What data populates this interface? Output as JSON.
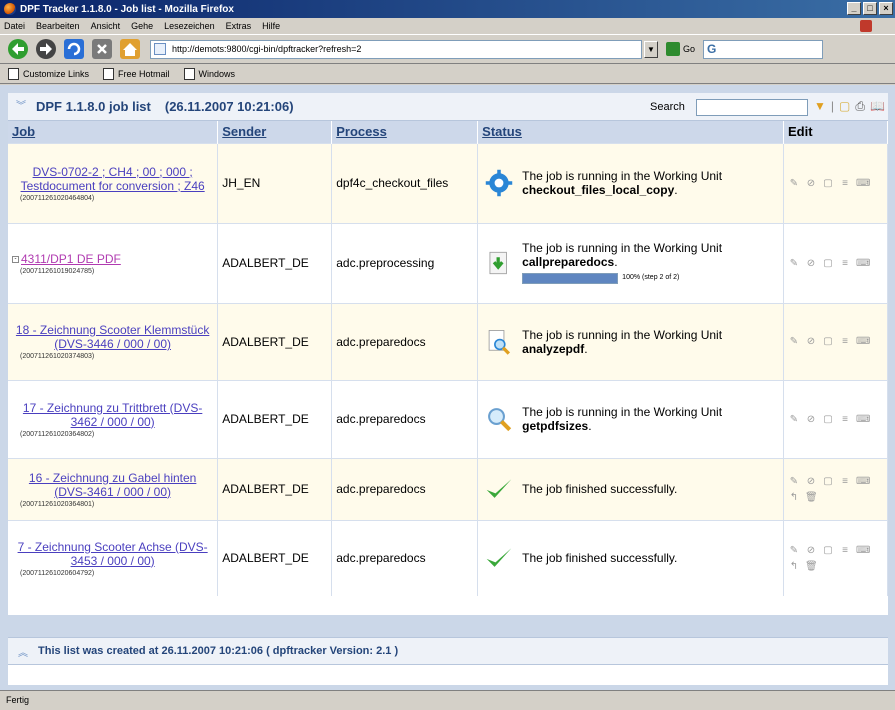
{
  "window": {
    "title": "DPF Tracker 1.1.8.0 - Job list - Mozilla Firefox"
  },
  "menu": [
    "Datei",
    "Bearbeiten",
    "Ansicht",
    "Gehe",
    "Lesezeichen",
    "Extras",
    "Hilfe"
  ],
  "navbar": {
    "url": "http://demots:9800/cgi-bin/dpftracker?refresh=2",
    "go_label": "Go",
    "search_value": "G"
  },
  "bookmarks": [
    "Customize Links",
    "Free Hotmail",
    "Windows"
  ],
  "list": {
    "title": "DPF 1.1.8.0 job list",
    "date": "(26.11.2007 10:21:06)",
    "search_label": "Search",
    "columns": {
      "job": "Job",
      "sender": "Sender",
      "process": "Process",
      "status": "Status",
      "edit": "Edit"
    },
    "rows": [
      {
        "job": "DVS-0702-2 ; CH4 ; 00 ; 000 ; Testdocument for conversion ; Z46",
        "id": "(20071126102046480​4)",
        "sender": "JH_EN",
        "process": "dpf4c_checkout_files",
        "status_line1": "The job is running in the Working Unit",
        "status_line2": "checkout_files_local_copy",
        "status_suffix": ".",
        "icon": "gear-icon"
      },
      {
        "job": "4311/DP1 DE PDF",
        "id": "(20071126101902478​5)",
        "sender": "ADALBERT_DE",
        "process": "adc.preprocessing",
        "status_line1": "The job is running in the Working Unit",
        "status_line2": "callpreparedocs",
        "status_suffix": ".",
        "progress_text": "100% (step 2 of 2)",
        "progress": 1.0,
        "icon": "download-icon"
      },
      {
        "job": "18 - Zeichnung Scooter Klemmstück (DVS-3446 / 000 / 00)",
        "id": "(20071126102037480​3)",
        "sender": "ADALBERT_DE",
        "process": "adc.preparedocs",
        "status_line1": "The job is running in the Working Unit",
        "status_line2": "analyzepdf",
        "status_suffix": ".",
        "icon": "document-search-icon"
      },
      {
        "job": "17 - Zeichnung zu Trittbrett (DVS-3462 / 000 / 00)",
        "id": "(20071126102036480​2)",
        "sender": "ADALBERT_DE",
        "process": "adc.preparedocs",
        "status_line1": "The job is running in the Working Unit",
        "status_line2": "getpdfsizes",
        "status_suffix": ".",
        "icon": "magnifier-icon"
      },
      {
        "job": "16 - Zeichnung zu Gabel hinten (DVS-3461 / 000 / 00)",
        "id": "(20071126102036480​1)",
        "sender": "ADALBERT_DE",
        "process": "adc.preparedocs",
        "status_line1": "The job finished successfully.",
        "status_line2": "",
        "status_suffix": "",
        "icon": "checkmark-icon"
      },
      {
        "job": "7 - Zeichnung Scooter Achse (DVS-3453 / 000 / 00)",
        "id": "(20071126102060479​2)",
        "sender": "ADALBERT_DE",
        "process": "adc.preparedocs",
        "status_line1": "The job finished successfully.",
        "status_line2": "",
        "status_suffix": "",
        "icon": "checkmark-icon"
      }
    ]
  },
  "footer": {
    "text": "This list was created at 26.11.2007 10:21:06 ( dpftracker Version: 2.1 )"
  },
  "statusbar": {
    "text": "Fertig"
  }
}
